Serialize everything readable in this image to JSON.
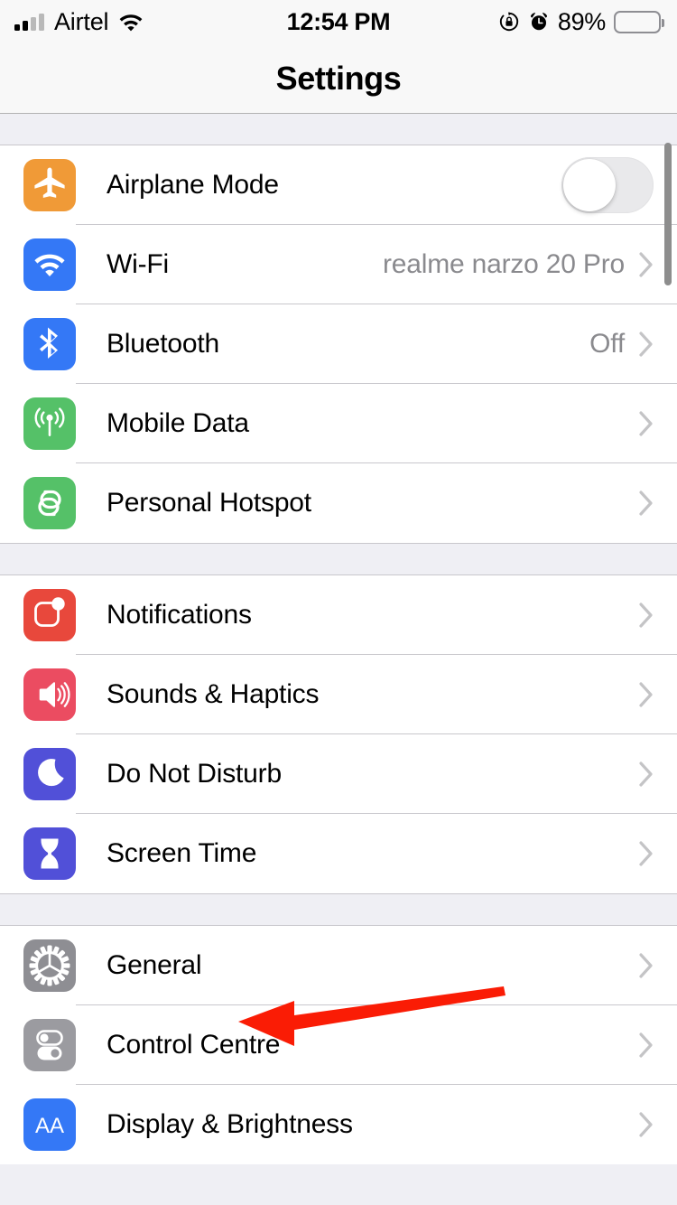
{
  "status_bar": {
    "carrier": "Airtel",
    "signal_icon": "cellular-signal-icon",
    "wifi_icon": "wifi-icon",
    "time": "12:54 PM",
    "rotation_lock_icon": "rotation-lock-icon",
    "alarm_icon": "alarm-clock-icon",
    "battery_percent": "89%",
    "battery_icon": "battery-icon",
    "battery_level": 89
  },
  "nav": {
    "title": "Settings"
  },
  "annotation": {
    "arrow_icon": "red-arrow-pointing-left",
    "color": "#FA1C05",
    "points_to": "General"
  },
  "colors": {
    "airplane": "#F09A37",
    "wifi": "#3478F6",
    "bluetooth": "#3478F6",
    "mobile_data": "#55C168",
    "hotspot": "#55C168",
    "notifications": "#E8483C",
    "sounds": "#EB4C61",
    "do_not_disturb": "#5150D8",
    "screen_time": "#5150D8",
    "general": "#8E8E93",
    "control_centre": "#9B9BA0",
    "display": "#3478F6",
    "separator": "#C8C7CC",
    "group_background": "#EFEFF4",
    "value_text": "#8A8A8E"
  },
  "groups": [
    {
      "rows": [
        {
          "label": "Airplane Mode",
          "icon": "airplane-icon",
          "icon_color_key": "airplane",
          "accessory": "toggle",
          "toggle_on": false,
          "value": ""
        },
        {
          "label": "Wi-Fi",
          "icon": "wifi-icon",
          "icon_color_key": "wifi",
          "accessory": "chevron",
          "value": "realme narzo 20 Pro"
        },
        {
          "label": "Bluetooth",
          "icon": "bluetooth-icon",
          "icon_color_key": "bluetooth",
          "accessory": "chevron",
          "value": "Off"
        },
        {
          "label": "Mobile Data",
          "icon": "mobile-data-icon",
          "icon_color_key": "mobile_data",
          "accessory": "chevron",
          "value": ""
        },
        {
          "label": "Personal Hotspot",
          "icon": "personal-hotspot-icon",
          "icon_color_key": "hotspot",
          "accessory": "chevron",
          "value": ""
        }
      ]
    },
    {
      "rows": [
        {
          "label": "Notifications",
          "icon": "notifications-icon",
          "icon_color_key": "notifications",
          "accessory": "chevron",
          "value": ""
        },
        {
          "label": "Sounds & Haptics",
          "icon": "sounds-icon",
          "icon_color_key": "sounds",
          "accessory": "chevron",
          "value": ""
        },
        {
          "label": "Do Not Disturb",
          "icon": "moon-icon",
          "icon_color_key": "do_not_disturb",
          "accessory": "chevron",
          "value": ""
        },
        {
          "label": "Screen Time",
          "icon": "hourglass-icon",
          "icon_color_key": "screen_time",
          "accessory": "chevron",
          "value": ""
        }
      ]
    },
    {
      "rows": [
        {
          "label": "General",
          "icon": "gear-icon",
          "icon_color_key": "general",
          "accessory": "chevron",
          "value": ""
        },
        {
          "label": "Control Centre",
          "icon": "control-centre-icon",
          "icon_color_key": "control_centre",
          "accessory": "chevron",
          "value": ""
        },
        {
          "label": "Display & Brightness",
          "icon": "display-brightness-icon",
          "icon_color_key": "display",
          "accessory": "chevron",
          "value": "AA"
        }
      ]
    }
  ]
}
